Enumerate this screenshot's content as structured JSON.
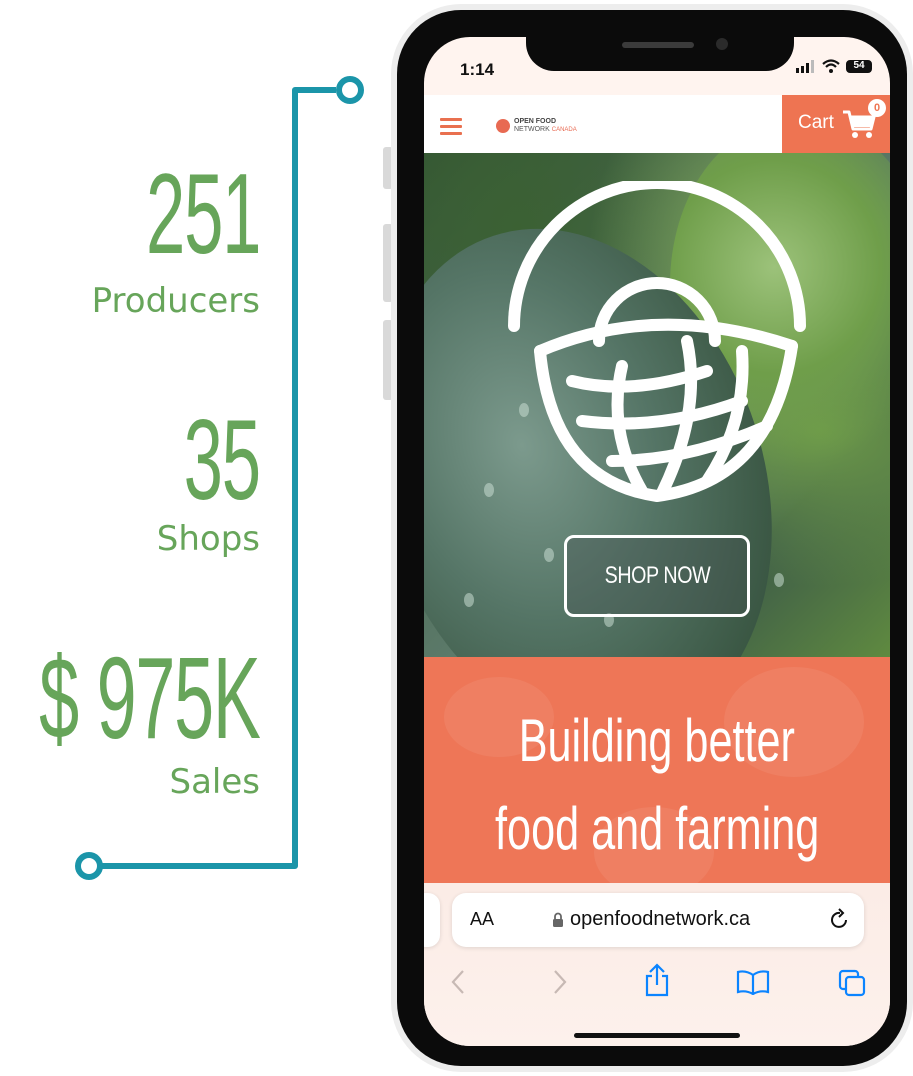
{
  "stats": [
    {
      "value": "251",
      "label": "Producers"
    },
    {
      "value": "35",
      "label": "Shops"
    },
    {
      "value": "$ 975K",
      "label": "Sales"
    }
  ],
  "colors": {
    "stat_green": "#67a55a",
    "timeline_teal": "#1b95a9",
    "brand_orange": "#ee7452"
  },
  "phone": {
    "status": {
      "time": "1:14",
      "battery": "54"
    },
    "header": {
      "brand_line1": "OPEN FOOD",
      "brand_line2": "NETWORK",
      "brand_line3": "CANADA",
      "cart_label": "Cart",
      "cart_count": "0"
    },
    "hero": {
      "cta": "SHOP NOW"
    },
    "tagline": {
      "line1": "Building better",
      "line2": "food and farming"
    },
    "browser": {
      "text_size_label": "AA",
      "url": "openfoodnetwork.ca",
      "toolbar_icons": [
        "back-icon",
        "forward-icon",
        "share-icon",
        "bookmarks-icon",
        "tabs-icon"
      ]
    }
  }
}
